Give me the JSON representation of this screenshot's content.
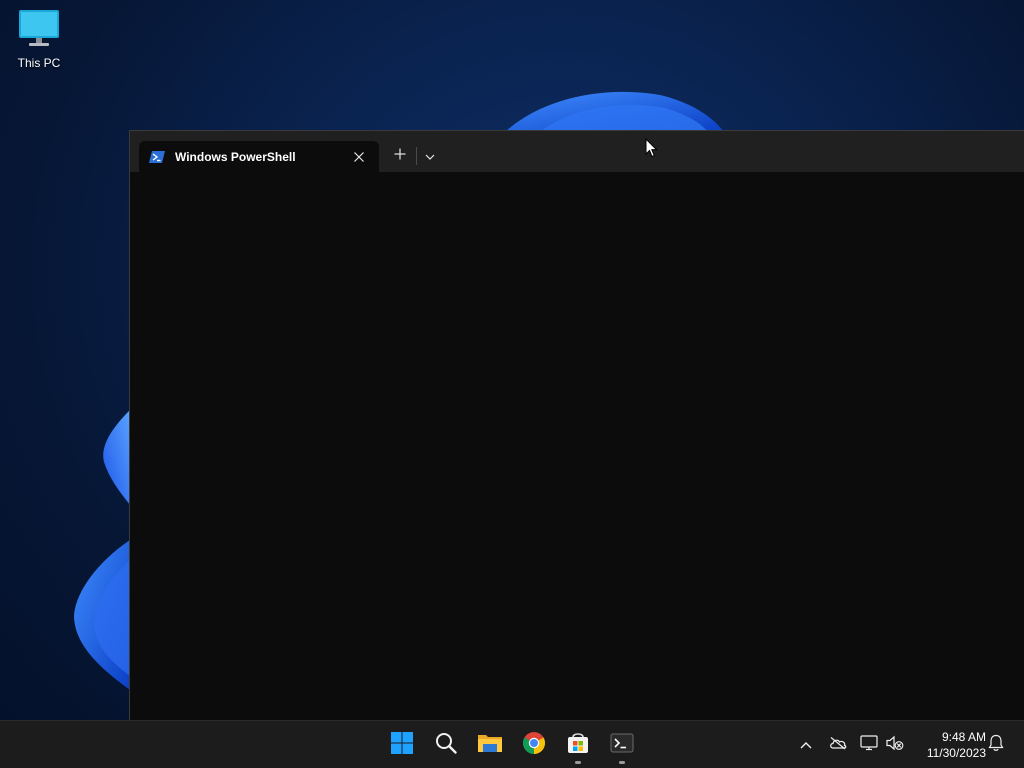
{
  "desktop": {
    "icons": [
      {
        "label": "This PC",
        "icon": "monitor-icon"
      }
    ]
  },
  "window": {
    "app": "Windows Terminal",
    "tabs": [
      {
        "label": "Windows PowerShell",
        "icon": "powershell-icon",
        "active": true
      }
    ],
    "new_tab_icon": "plus-icon",
    "dropdown_icon": "chevron-down-icon",
    "close_tab_icon": "close-icon"
  },
  "taskbar": {
    "pinned": [
      {
        "name": "start",
        "icon": "windows-logo-icon",
        "running": false
      },
      {
        "name": "search",
        "icon": "search-icon",
        "running": false
      },
      {
        "name": "file-explorer",
        "icon": "folder-icon",
        "running": false
      },
      {
        "name": "chrome",
        "icon": "chrome-icon",
        "running": false
      },
      {
        "name": "microsoft-store",
        "icon": "store-icon",
        "running": true
      },
      {
        "name": "terminal",
        "icon": "terminal-icon",
        "running": true
      }
    ],
    "tray": {
      "icons": [
        "chevron-up-icon",
        "onedrive-offline-icon",
        "network-icon",
        "volume-muted-icon"
      ],
      "time": "9:48 AM",
      "date": "11/30/2023",
      "notification_icon": "bell-icon"
    }
  },
  "colors": {
    "taskbar_bg": "#1c1c1c",
    "titlebar_bg": "#202020",
    "terminal_bg": "#0c0c0c",
    "accent_blue": "#1f6fe0"
  }
}
